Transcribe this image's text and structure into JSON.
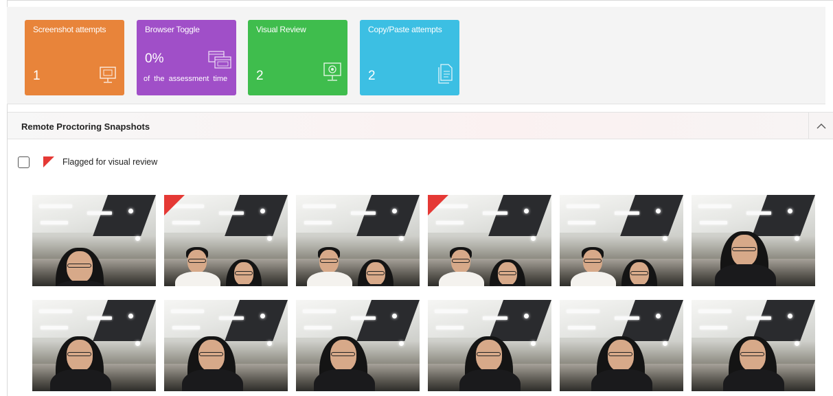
{
  "stats": {
    "screenshot": {
      "title": "Screenshot attempts",
      "value": "1",
      "icon": "monitor-icon",
      "color": "#e8843a"
    },
    "browser_toggle": {
      "title": "Browser Toggle",
      "value": "0%",
      "sub": "of the assessment time",
      "icon": "browser-windows-icon",
      "color": "#a04fc8"
    },
    "visual_review": {
      "title": "Visual Review",
      "value": "2",
      "icon": "webcam-monitor-icon",
      "color": "#3fbd4d"
    },
    "copy_paste": {
      "title": "Copy/Paste attempts",
      "value": "2",
      "icon": "documents-icon",
      "color": "#3cbfe3"
    }
  },
  "section": {
    "title": "Remote Proctoring Snapshots",
    "collapse_icon": "chevron-up-icon"
  },
  "legend": {
    "label": "Flagged for visual review",
    "flag_color": "#e53935",
    "checked": false
  },
  "snapshots": [
    {
      "row": 1,
      "col": 1,
      "flagged": false,
      "people": 1
    },
    {
      "row": 1,
      "col": 2,
      "flagged": true,
      "people": 2
    },
    {
      "row": 1,
      "col": 3,
      "flagged": false,
      "people": 2
    },
    {
      "row": 1,
      "col": 4,
      "flagged": true,
      "people": 2
    },
    {
      "row": 1,
      "col": 5,
      "flagged": false,
      "people": 2
    },
    {
      "row": 1,
      "col": 6,
      "flagged": false,
      "people": 1
    },
    {
      "row": 2,
      "col": 1,
      "flagged": false,
      "people": 1
    },
    {
      "row": 2,
      "col": 2,
      "flagged": false,
      "people": 1
    },
    {
      "row": 2,
      "col": 3,
      "flagged": false,
      "people": 1
    },
    {
      "row": 2,
      "col": 4,
      "flagged": false,
      "people": 1
    },
    {
      "row": 2,
      "col": 5,
      "flagged": false,
      "people": 1
    },
    {
      "row": 2,
      "col": 6,
      "flagged": false,
      "people": 1
    }
  ]
}
